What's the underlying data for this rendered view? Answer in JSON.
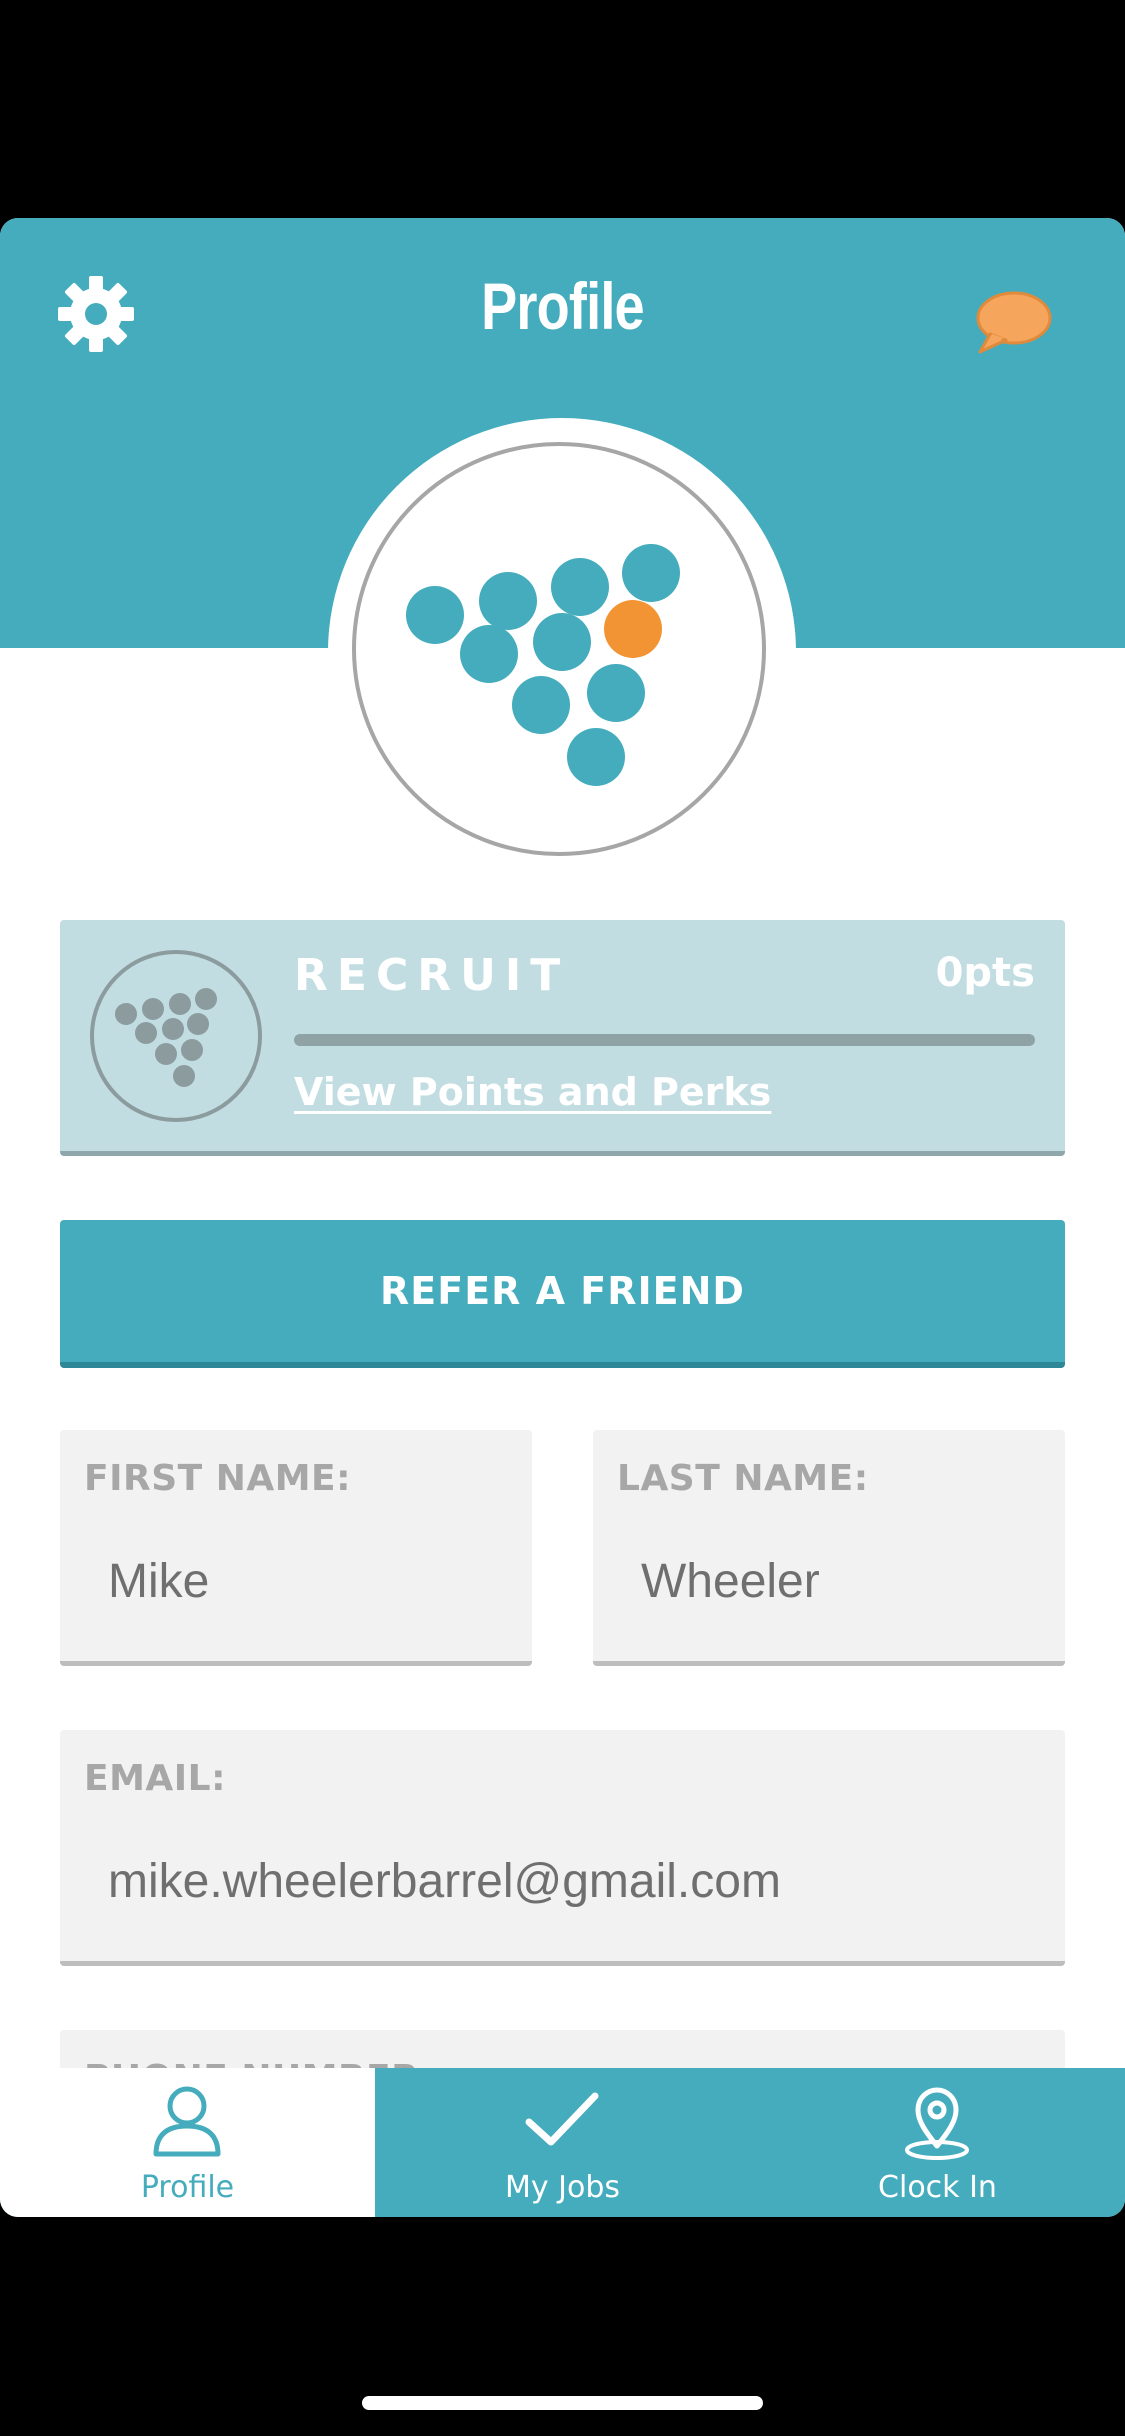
{
  "header": {
    "title": "Profile",
    "settings_icon": "gear-icon",
    "messages_icon": "chat-bubble-icon",
    "color": "#44acbd",
    "accent_color": "#f6a55c"
  },
  "rank": {
    "name": "RECRUIT",
    "points": "0pts",
    "progress": 0,
    "link_label": "View Points and Perks"
  },
  "refer_button": {
    "label": "REFER A FRIEND"
  },
  "form": {
    "first_name": {
      "label": "FIRST NAME:",
      "value": "Mike"
    },
    "last_name": {
      "label": "LAST NAME:",
      "value": "Wheeler"
    },
    "email": {
      "label": "EMAIL:",
      "value": "mike.wheelerbarrel@gmail.com"
    },
    "phone": {
      "label": "PHONE NUMBER:"
    }
  },
  "tabbar": {
    "tabs": [
      {
        "label": "Profile",
        "icon": "person-icon",
        "active": true
      },
      {
        "label": "My Jobs",
        "icon": "checkmark-icon",
        "active": false
      },
      {
        "label": "Clock In",
        "icon": "map-pin-icon",
        "active": false
      }
    ]
  }
}
